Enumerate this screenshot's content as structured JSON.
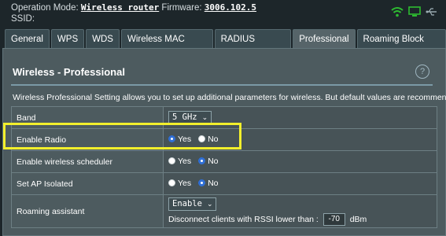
{
  "status": {
    "operation_mode_label": "Operation Mode:",
    "operation_mode_value": "Wireless router",
    "firmware_label": "Firmware:",
    "firmware_value": "3006.102.5",
    "ssid_label": "SSID:",
    "icons": [
      "wifi-icon",
      "client-status-icon",
      "usb-icon"
    ],
    "icon_color": "#2dbb31"
  },
  "tabs": [
    {
      "label": "General",
      "active": false
    },
    {
      "label": "WPS",
      "active": false
    },
    {
      "label": "WDS",
      "active": false
    },
    {
      "label": "Wireless MAC Filter",
      "active": false
    },
    {
      "label": "RADIUS Setting",
      "active": false
    },
    {
      "label": "Professional",
      "active": true
    },
    {
      "label": "Roaming Block List",
      "active": false
    }
  ],
  "panel": {
    "title": "Wireless - Professional",
    "help_label": "?",
    "description": "Wireless Professional Setting allows you to set up additional parameters for wireless. But default values are recommended."
  },
  "settings": {
    "band": {
      "label": "Band",
      "value": "5 GHz"
    },
    "enable_radio": {
      "label": "Enable Radio",
      "yes": "Yes",
      "no": "No",
      "selected": "Yes"
    },
    "scheduler": {
      "label": "Enable wireless scheduler",
      "yes": "Yes",
      "no": "No",
      "selected": "No"
    },
    "ap_isolated": {
      "label": "Set AP Isolated",
      "yes": "Yes",
      "no": "No",
      "selected": "No"
    },
    "roaming": {
      "label": "Roaming assistant",
      "value": "Enable",
      "rssi_prefix": "Disconnect clients with RSSI lower than :",
      "rssi_value": "-70",
      "rssi_unit": "dBm"
    }
  },
  "colors": {
    "highlight": "#f2ef2c",
    "radio_selected": "#2f6fd6"
  }
}
